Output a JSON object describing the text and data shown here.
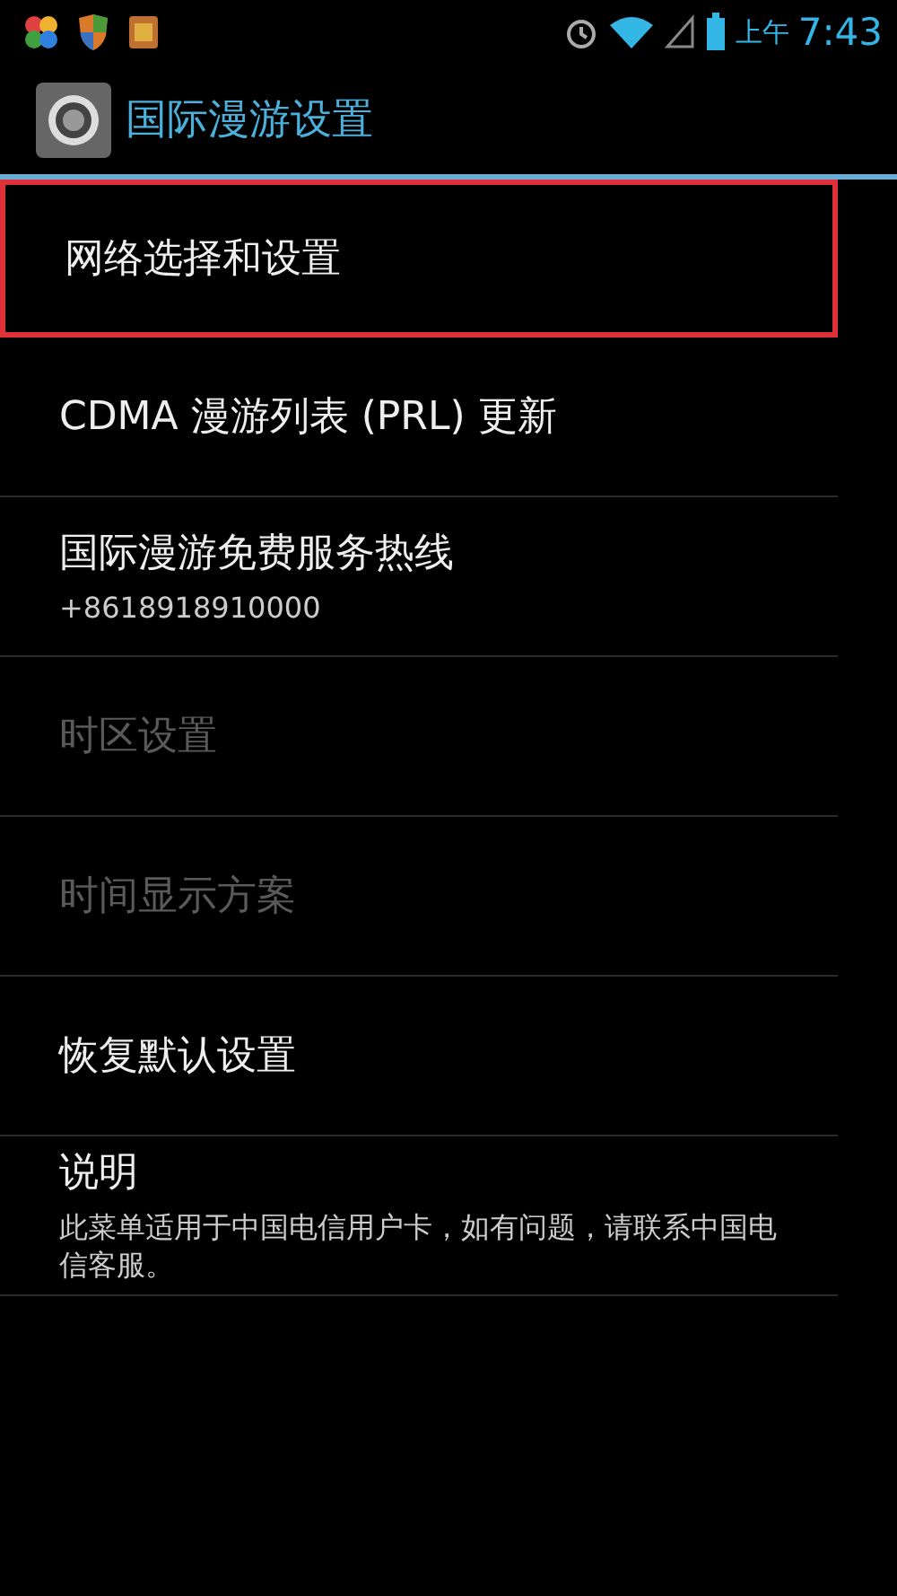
{
  "status_bar": {
    "period": "上午",
    "time": "7:43"
  },
  "header": {
    "title": "国际漫游设置"
  },
  "items": [
    {
      "title": "网络选择和设置",
      "disabled": false,
      "highlighted": true
    },
    {
      "title": "CDMA 漫游列表 (PRL) 更新",
      "disabled": false,
      "highlighted": false
    },
    {
      "title": "国际漫游免费服务热线",
      "summary": "+8618918910000",
      "disabled": false,
      "highlighted": false
    },
    {
      "title": "时区设置",
      "disabled": true,
      "highlighted": false
    },
    {
      "title": "时间显示方案",
      "disabled": true,
      "highlighted": false
    },
    {
      "title": "恢复默认设置",
      "disabled": false,
      "highlighted": false
    },
    {
      "title": "说明",
      "summary": "此菜单适用于中国电信用户卡，如有问题，请联系中国电信客服。",
      "disabled": false,
      "highlighted": false
    }
  ]
}
